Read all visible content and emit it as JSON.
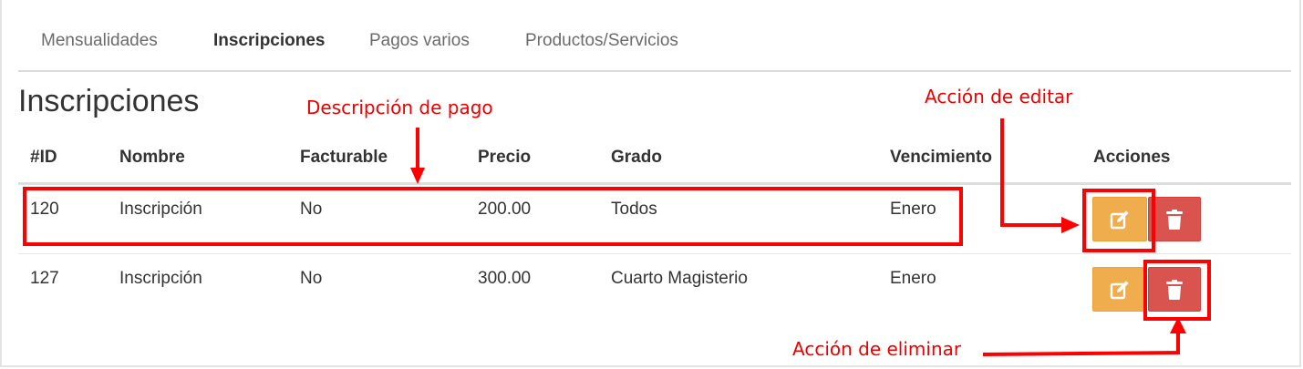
{
  "tabs": [
    {
      "label": "Mensualidades",
      "active": false
    },
    {
      "label": "Inscripciones",
      "active": true
    },
    {
      "label": "Pagos varios",
      "active": false
    },
    {
      "label": "Productos/Servicios",
      "active": false
    }
  ],
  "page_title": "Inscripciones",
  "table": {
    "headers": [
      "#ID",
      "Nombre",
      "Facturable",
      "Precio",
      "Grado",
      "Vencimiento",
      "Acciones"
    ],
    "rows": [
      {
        "id": "120",
        "nombre": "Inscripción",
        "facturable": "No",
        "precio": "200.00",
        "grado": "Todos",
        "vencimiento": "Enero"
      },
      {
        "id": "127",
        "nombre": "Inscripción",
        "facturable": "No",
        "precio": "300.00",
        "grado": "Cuarto Magisterio",
        "vencimiento": "Enero"
      }
    ]
  },
  "actions": {
    "edit_icon": "edit-icon",
    "delete_icon": "trash-icon"
  },
  "annotations": {
    "payment_description": "Descripción de pago",
    "edit_action": "Acción de editar",
    "delete_action": "Acción de eliminar"
  },
  "colors": {
    "edit_button": "#f0ad4e",
    "delete_button": "#d9534f",
    "annotation": "#ff0000"
  }
}
